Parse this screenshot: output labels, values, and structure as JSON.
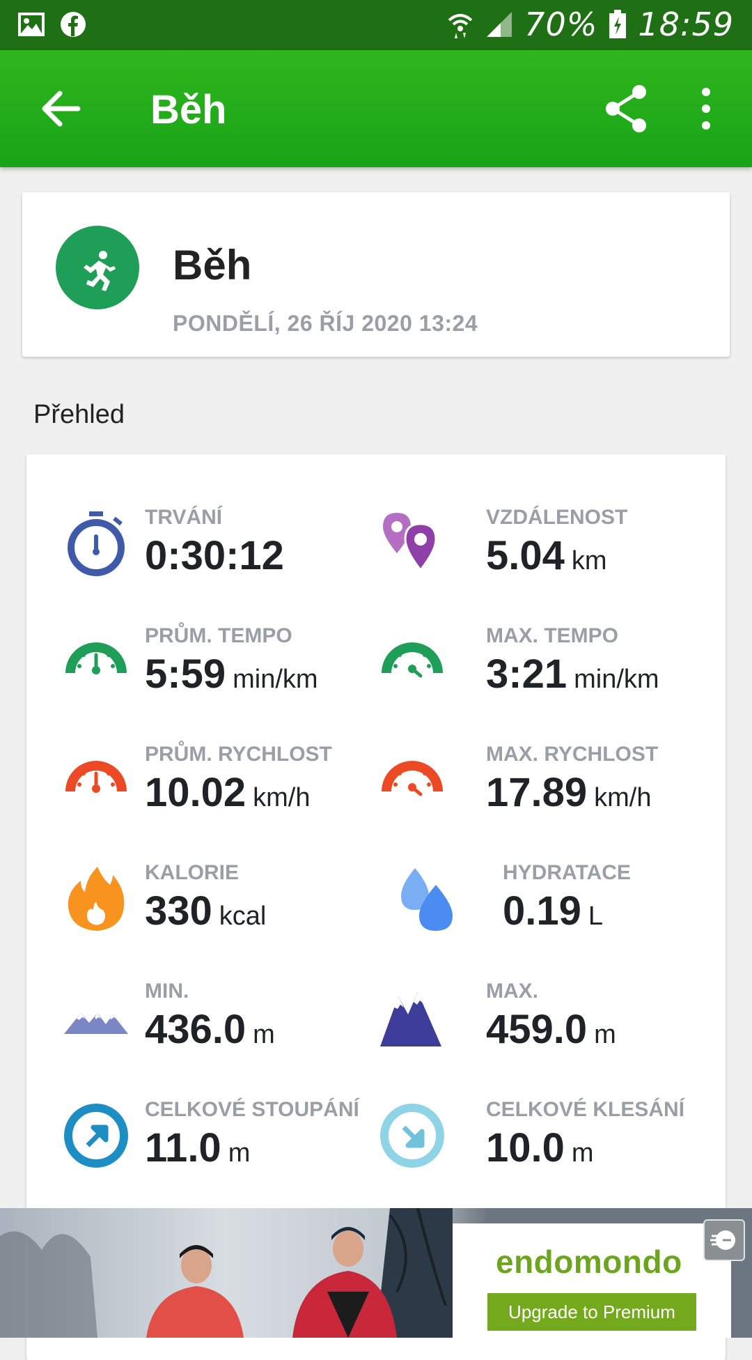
{
  "status_bar": {
    "battery": "70%",
    "time": "18:59",
    "icons": [
      "gallery-icon",
      "facebook-icon",
      "wifi-icon",
      "signal-icon",
      "battery-icon"
    ]
  },
  "toolbar": {
    "title": "Běh",
    "back_icon": "arrow-left-icon",
    "share_icon": "share-icon",
    "more_icon": "more-vert-icon"
  },
  "activity": {
    "title": "Běh",
    "date": "PONDĚLÍ, 26 ŘÍJ 2020 13:24",
    "icon": "running-icon"
  },
  "overview": {
    "title": "Přehled",
    "stats": [
      {
        "label": "TRVÁNÍ",
        "value": "0:30:12",
        "unit": "",
        "icon": "stopwatch-icon",
        "color": "#3f5aa8"
      },
      {
        "label": "VZDÁLENOST",
        "value": "5.04",
        "unit": "km",
        "icon": "map-pins-icon",
        "color": "#8e3fa8"
      },
      {
        "label": "PRŮM. TEMPO",
        "value": "5:59",
        "unit": "min/km",
        "icon": "gauge-icon",
        "color": "#1f9e57"
      },
      {
        "label": "MAX. TEMPO",
        "value": "3:21",
        "unit": "min/km",
        "icon": "gauge-icon",
        "color": "#1f9e57"
      },
      {
        "label": "PRŮM. RYCHLOST",
        "value": "10.02",
        "unit": "km/h",
        "icon": "speedometer-icon",
        "color": "#ec4a24"
      },
      {
        "label": "MAX. RYCHLOST",
        "value": "17.89",
        "unit": "km/h",
        "icon": "speedometer-icon",
        "color": "#ec4a24"
      },
      {
        "label": "KALORIE",
        "value": "330",
        "unit": "kcal",
        "icon": "flame-icon",
        "color": "#f7931e"
      },
      {
        "label": "HYDRATACE",
        "value": "0.19",
        "unit": "L",
        "icon": "water-drops-icon",
        "color": "#4a8cf0"
      },
      {
        "label": "MIN.",
        "value": "436.0",
        "unit": "m",
        "icon": "mountains-low-icon",
        "color": "#7b87c4"
      },
      {
        "label": "MAX.",
        "value": "459.0",
        "unit": "m",
        "icon": "mountains-high-icon",
        "color": "#3e3d9a"
      },
      {
        "label": "CELKOVÉ STOUPÁNÍ",
        "value": "11.0",
        "unit": "m",
        "icon": "ascent-icon",
        "color": "#1d8ec4"
      },
      {
        "label": "CELKOVÉ KLESÁNÍ",
        "value": "10.0",
        "unit": "m",
        "icon": "descent-icon",
        "color": "#8fd3e6"
      }
    ]
  },
  "ad": {
    "brand": "endomondo",
    "button": "Upgrade to Premium"
  }
}
